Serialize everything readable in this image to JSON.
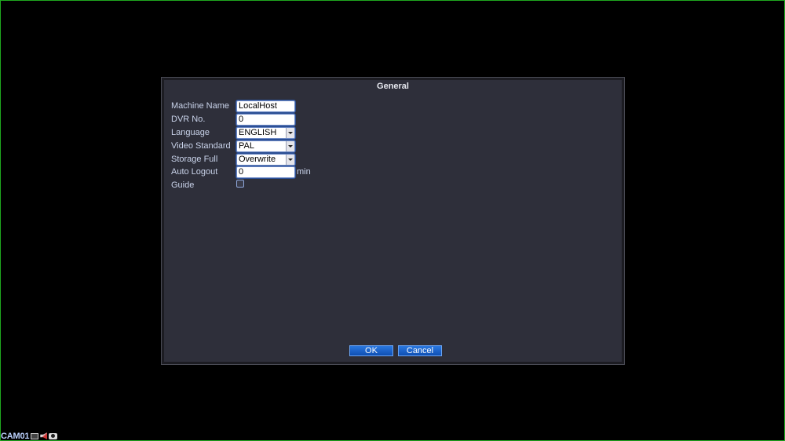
{
  "dialog": {
    "title": "General",
    "fields": {
      "machine_name": {
        "label": "Machine Name",
        "value": "LocalHost"
      },
      "dvr_no": {
        "label": "DVR No.",
        "value": "0"
      },
      "language": {
        "label": "Language",
        "value": "ENGLISH"
      },
      "video_standard": {
        "label": "Video Standard",
        "value": "PAL"
      },
      "storage_full": {
        "label": "Storage Full",
        "value": "Overwrite"
      },
      "auto_logout": {
        "label": "Auto Logout",
        "value": "0",
        "unit": "min"
      },
      "guide": {
        "label": "Guide",
        "checked": false
      }
    },
    "buttons": {
      "ok": "OK",
      "cancel": "Cancel"
    }
  },
  "statusbar": {
    "camera_label": "CAM01",
    "icons": [
      "record-icon",
      "speaker-muted-icon",
      "camera-icon"
    ]
  },
  "colors": {
    "dialog_bg": "#2e2f3a",
    "label_text": "#c9d3ea",
    "button_blue": "#1a5fc8",
    "screen_border": "#1fa81f"
  }
}
